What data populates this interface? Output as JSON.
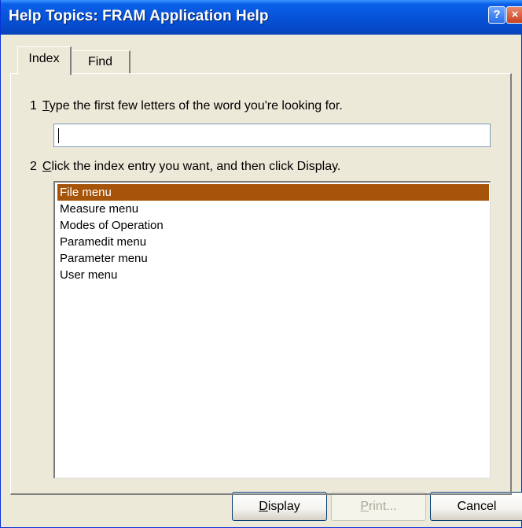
{
  "window": {
    "title": "Help Topics: FRAM Application Help",
    "help_glyph": "?",
    "close_glyph": "×"
  },
  "tabs": [
    {
      "label": "Index",
      "active": true
    },
    {
      "label": "Find",
      "active": false
    }
  ],
  "step1": {
    "number": "1",
    "access_key": "T",
    "text": "ype the first few letters of the word you're looking for."
  },
  "search": {
    "value": "",
    "placeholder": ""
  },
  "step2": {
    "number": "2",
    "access_key": "C",
    "text": "lick the index entry you want, and then click Display."
  },
  "list": {
    "items": [
      "File menu",
      "Measure menu",
      "Modes of Operation",
      "Paramedit menu",
      "Parameter menu",
      "User menu"
    ],
    "selected_index": 0
  },
  "buttons": {
    "display_key": "D",
    "display_rest": "isplay",
    "print_key": "P",
    "print_rest": "rint...",
    "print_enabled": false,
    "cancel": "Cancel"
  },
  "colors": {
    "title_bar": "#0653d8",
    "selection": "#a6540a",
    "face": "#ece9d8"
  }
}
